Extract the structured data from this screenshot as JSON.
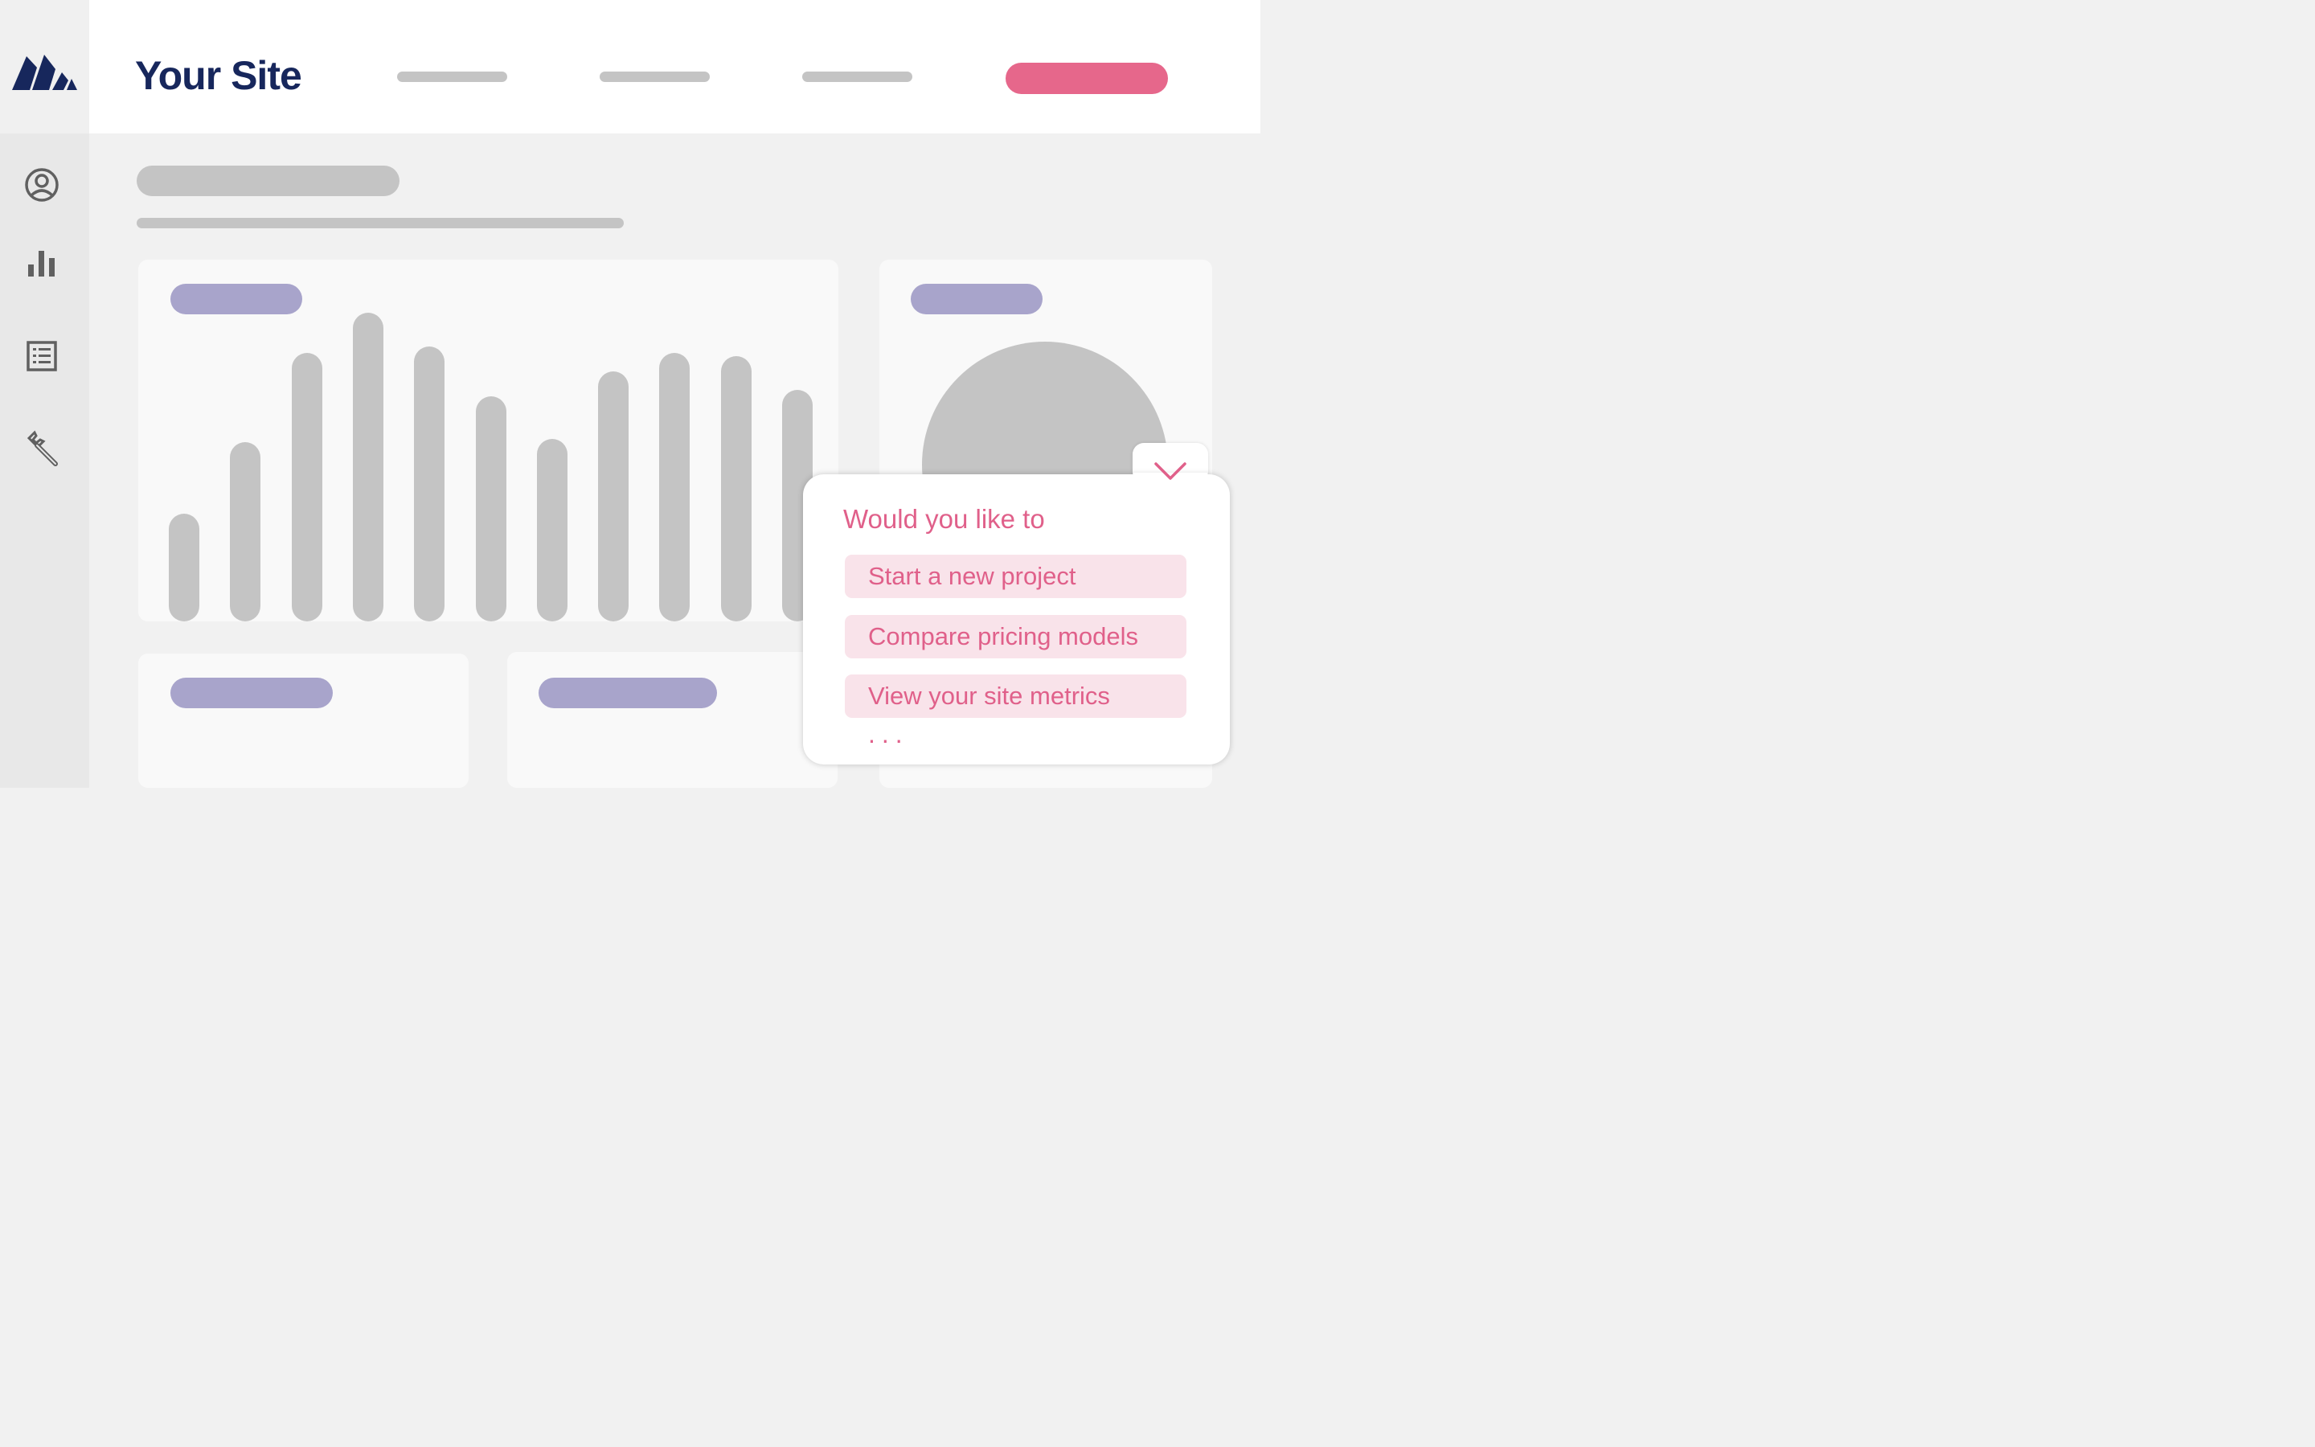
{
  "header": {
    "site_title": "Your Site"
  },
  "colors": {
    "brand_navy": "#17275c",
    "accent_pink": "#e6678b",
    "pill_purple": "#a8a4cb",
    "placeholder_gray": "#c4c4c4"
  },
  "sidebar": {
    "icons": [
      "user-circle-icon",
      "bar-chart-icon",
      "list-document-icon",
      "wrench-icon"
    ]
  },
  "chart_data": {
    "type": "bar",
    "values": [
      35,
      58,
      87,
      100,
      89,
      73,
      59,
      81,
      87,
      86,
      75
    ],
    "ylim": [
      0,
      100
    ]
  },
  "assistant": {
    "prompt": "Would you like to",
    "options": [
      "Start a new project",
      "Compare pricing models",
      "View your site metrics"
    ],
    "more": "..."
  }
}
